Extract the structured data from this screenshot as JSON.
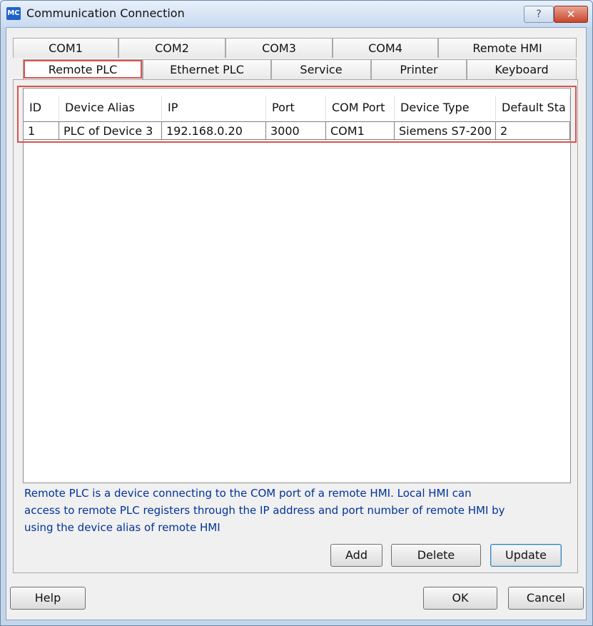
{
  "window": {
    "icon_text": "MC",
    "title": "Communication Connection",
    "help_glyph": "?",
    "close_glyph": "✕"
  },
  "tabs_row1": [
    "COM1",
    "COM2",
    "COM3",
    "COM4",
    "Remote HMI"
  ],
  "tabs_row2": [
    "Remote PLC",
    "Ethernet PLC",
    "Service",
    "Printer",
    "Keyboard"
  ],
  "active_tab": "Remote PLC",
  "table": {
    "columns": [
      "ID",
      "Device Alias",
      "IP",
      "Port",
      "COM Port",
      "Device Type",
      "Default Sta"
    ],
    "rows": [
      [
        "1",
        "PLC of Device 3",
        "192.168.0.20",
        "3000",
        "COM1",
        "Siemens S7-200",
        "2"
      ]
    ]
  },
  "description": {
    "line1": "Remote PLC is a device connecting to the COM port of a remote HMI. Local HMI can",
    "line2": "access to remote PLC registers through the IP address and port number of remote HMI by",
    "line3": "using the device alias of remote HMI"
  },
  "buttons": {
    "add": "Add",
    "delete": "Delete",
    "update": "Update",
    "help": "Help",
    "ok": "OK",
    "cancel": "Cancel"
  },
  "colors": {
    "highlight": "#d9534f",
    "description_text": "#003399",
    "title_bar": "#c8daf0"
  }
}
